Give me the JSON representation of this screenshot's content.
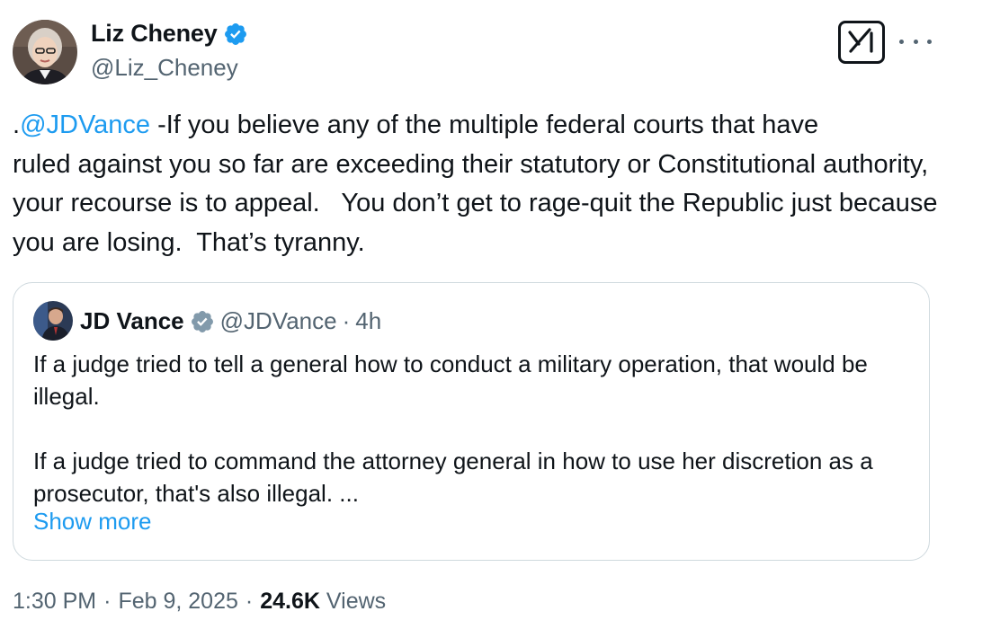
{
  "author": {
    "name": "Liz Cheney",
    "handle": "@Liz_Cheney",
    "verified_color": "#1d9bf0"
  },
  "actions": {
    "grok_icon": "grok-icon",
    "more_icon": "more-options-icon"
  },
  "tweet": {
    "prefix": ".",
    "mention": "@JDVance",
    "text_line1_rest": " -If you believe any of the multiple federal courts that have",
    "text_rest": "ruled against you so far are exceeding their statutory or Constitutional authority, your recourse is to appeal.   You don’t get to rage-quit the Republic just because you are losing.  That’s tyranny."
  },
  "quote": {
    "name": "JD Vance",
    "handle": "@JDVance",
    "dot": "·",
    "time": "4h",
    "paragraph1": "If a judge tried to tell a general how to conduct a military operation, that would be illegal.",
    "paragraph2": "If a judge tried to command the attorney general in how to use her discretion as a prosecutor, that's also illegal. ...",
    "show_more": "Show more",
    "badge_color": "#829aab"
  },
  "meta": {
    "time": "1:30 PM",
    "sep1": "·",
    "date": "Feb 9, 2025",
    "sep2": "·",
    "views_count": "24.6K",
    "views_label": "Views"
  }
}
